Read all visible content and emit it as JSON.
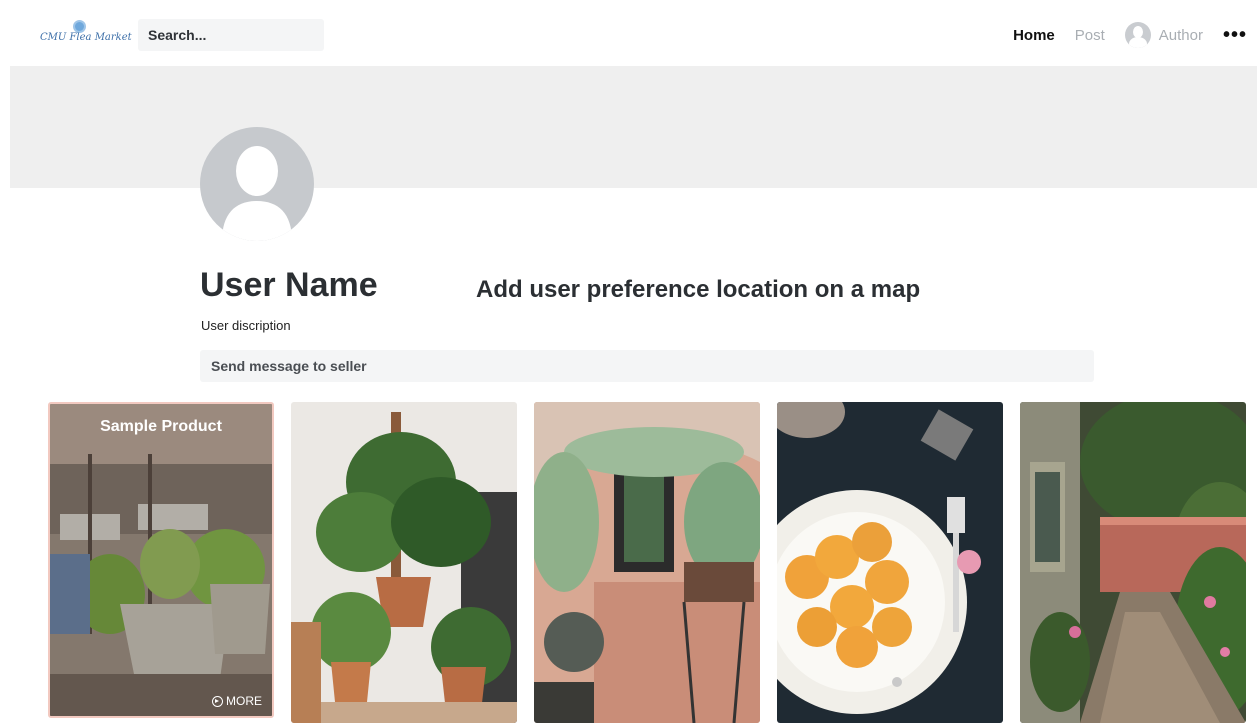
{
  "navbar": {
    "logo_text": "CMU Flea Market",
    "search_placeholder": "Search...",
    "links": {
      "home": "Home",
      "post": "Post",
      "author": "Author"
    },
    "more_label": "•••"
  },
  "profile": {
    "name": "User Name",
    "description": "User discription",
    "map_note": "Add user preference location on a map",
    "message_placeholder": "Send message to seller"
  },
  "products": [
    {
      "title": "Sample Product",
      "more_label": "MORE",
      "image": "potted-plants-welcome-sign"
    },
    {
      "image": "indoor-plants"
    },
    {
      "image": "courtyard-banana-leaves"
    },
    {
      "image": "apricot-dessert-plate"
    },
    {
      "image": "garden-cobblestone-path"
    }
  ],
  "colors": {
    "cover": "#efefef",
    "input_bg": "#f4f5f6",
    "avatar": "#c6c9cd",
    "text_dark": "#2b2f33",
    "nav_muted": "#a9aeb3"
  }
}
